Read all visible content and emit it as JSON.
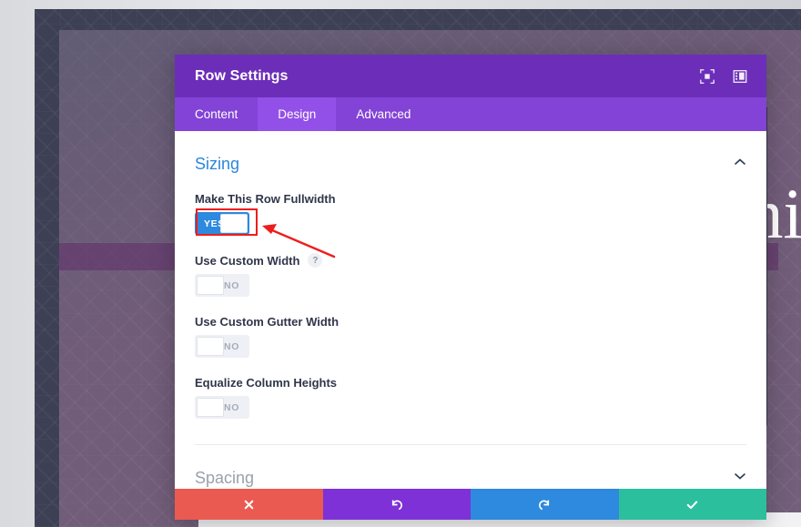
{
  "background": {
    "hero_text": "hi",
    "page_scrollbar": "page-scrollbar"
  },
  "modal": {
    "title": "Row Settings",
    "header_icons": [
      {
        "name": "fullscreen-icon",
        "label": "Fullscreen"
      },
      {
        "name": "layout-toggle-icon",
        "label": "Change Layout"
      }
    ],
    "tabs": [
      {
        "label": "Content",
        "active": false
      },
      {
        "label": "Design",
        "active": true
      },
      {
        "label": "Advanced",
        "active": false
      }
    ],
    "sections": [
      {
        "title": "Sizing",
        "expanded": true,
        "chevron": "chevron-up-icon",
        "fields": [
          {
            "label": "Make This Row Fullwidth",
            "toggle_value": "YES",
            "state": "on",
            "has_help": false,
            "highlighted": true
          },
          {
            "label": "Use Custom Width",
            "toggle_value": "NO",
            "state": "off",
            "has_help": true,
            "help_glyph": "?",
            "highlighted": false
          },
          {
            "label": "Use Custom Gutter Width",
            "toggle_value": "NO",
            "state": "off",
            "has_help": false,
            "highlighted": false
          },
          {
            "label": "Equalize Column Heights",
            "toggle_value": "NO",
            "state": "off",
            "has_help": false,
            "highlighted": false
          }
        ]
      },
      {
        "title": "Spacing",
        "expanded": false,
        "chevron": "chevron-down-icon",
        "fields": []
      }
    ],
    "footer": [
      {
        "name": "cancel-button",
        "icon": "close-icon",
        "color": "#ea5a51"
      },
      {
        "name": "undo-button",
        "icon": "undo-icon",
        "color": "#7d31d6"
      },
      {
        "name": "redo-button",
        "icon": "redo-icon",
        "color": "#2d8ade"
      },
      {
        "name": "save-button",
        "icon": "check-icon",
        "color": "#2bbf9d"
      }
    ]
  },
  "annotation": {
    "type": "red-arrow-and-box",
    "target": "Make This Row Fullwidth toggle",
    "box_color": "#ee1d1d",
    "arrow_color": "#ee1d1d"
  },
  "colors": {
    "header_purple": "#6c2eb9",
    "tabs_purple": "#8343d6",
    "tab_active_purple": "#9250e8",
    "section_blue": "#2b87da",
    "toggle_on_blue": "#2d8ade",
    "toggle_off_grey": "#eef0f5"
  }
}
